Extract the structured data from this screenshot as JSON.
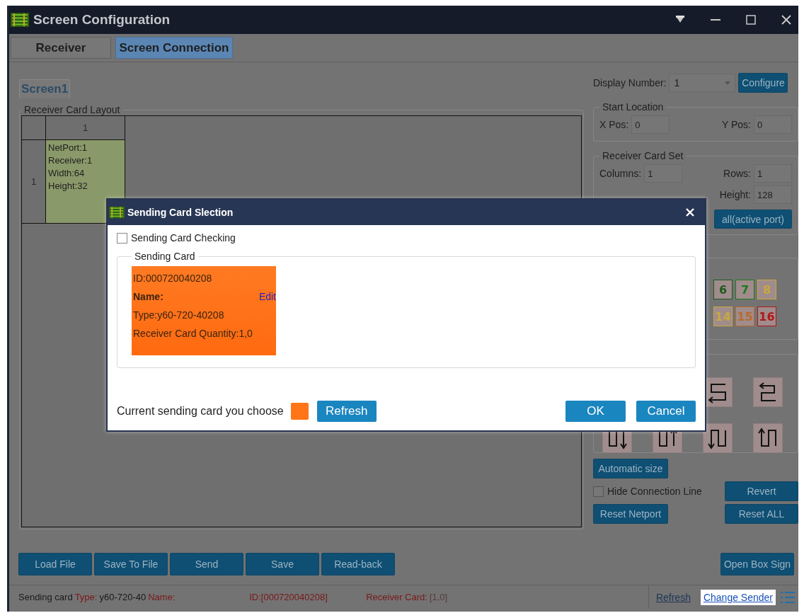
{
  "window": {
    "title": "Screen Configuration"
  },
  "tabs": [
    {
      "label": "Receiver",
      "selected": false
    },
    {
      "label": "Screen Connection",
      "selected": true
    }
  ],
  "screen_tabs": [
    {
      "label": "Screen1",
      "selected": true
    }
  ],
  "layout": {
    "title": "Receiver Card Layout",
    "column_headers": [
      "1"
    ],
    "row_headers": [
      "1"
    ],
    "cells": [
      {
        "lines": [
          "NetPort:1",
          "Receiver:1",
          "Width:64",
          "Height:32"
        ]
      }
    ]
  },
  "settings": {
    "display_number": {
      "label": "Display Number:",
      "value": "1"
    },
    "configure": "Configure",
    "start_location": {
      "title": "Start Location",
      "fields": [
        {
          "label": "X Pos:",
          "value": "0"
        },
        {
          "label": "Y Pos:",
          "value": "0"
        }
      ]
    },
    "receiver_card_set": {
      "title": "Receiver Card Set",
      "fields": [
        {
          "label": "Columns:",
          "value": "1"
        },
        {
          "label": "Rows:",
          "value": "1"
        },
        {
          "label": "Height:",
          "value": "128"
        }
      ],
      "button": "all(active port)"
    },
    "netport_tiles": [
      {
        "label": "6",
        "color": "#1e5a1e"
      },
      {
        "label": "7",
        "color": "#1f7a1f"
      },
      {
        "label": "8",
        "color": "#c8a93c"
      },
      {
        "label": "14",
        "color": "#c8a93c"
      },
      {
        "label": "15",
        "color": "#b86a2a"
      },
      {
        "label": "16",
        "color": "#b01818"
      }
    ],
    "automatic_size": "Automatic size",
    "hide_connection_line": {
      "label": "Hide Connection Line",
      "checked": false
    },
    "revert": "Revert",
    "reset_netport": "Reset Netport",
    "reset_all": "Reset ALL"
  },
  "bottom_buttons": [
    "Load File",
    "Save To File",
    "Send",
    "Save",
    "Read-back"
  ],
  "open_box_sign": "Open Box Sign",
  "status_bar": {
    "segments": [
      {
        "text": "Sending card",
        "kind": "label"
      },
      {
        "text": "Type:",
        "kind": "key"
      },
      {
        "text": "y60-720-40",
        "kind": "label"
      },
      {
        "text": "Name:",
        "kind": "key"
      },
      {
        "text": "ID:[000720040208]",
        "kind": "key"
      },
      {
        "text": "Receiver Card:",
        "kind": "key"
      },
      {
        "text": "[1,0]",
        "kind": "muted"
      }
    ],
    "links": [
      {
        "label": "Refresh",
        "selected": false
      },
      {
        "label": "Change Sender",
        "selected": true
      }
    ]
  },
  "dialog": {
    "title": "Sending Card Slection",
    "checking": {
      "label": "Sending Card Checking",
      "checked": false
    },
    "group_title": "Sending Card",
    "cards": [
      {
        "id": "ID:000720040208",
        "name": "Name:",
        "edit": "Edit",
        "type": "Type:y60-720-40208",
        "quantity": "Receiver Card Quantity:1,0",
        "selected": true
      }
    ],
    "current_label": "Current sending card you choose",
    "refresh": "Refresh",
    "ok": "OK",
    "cancel": "Cancel"
  }
}
